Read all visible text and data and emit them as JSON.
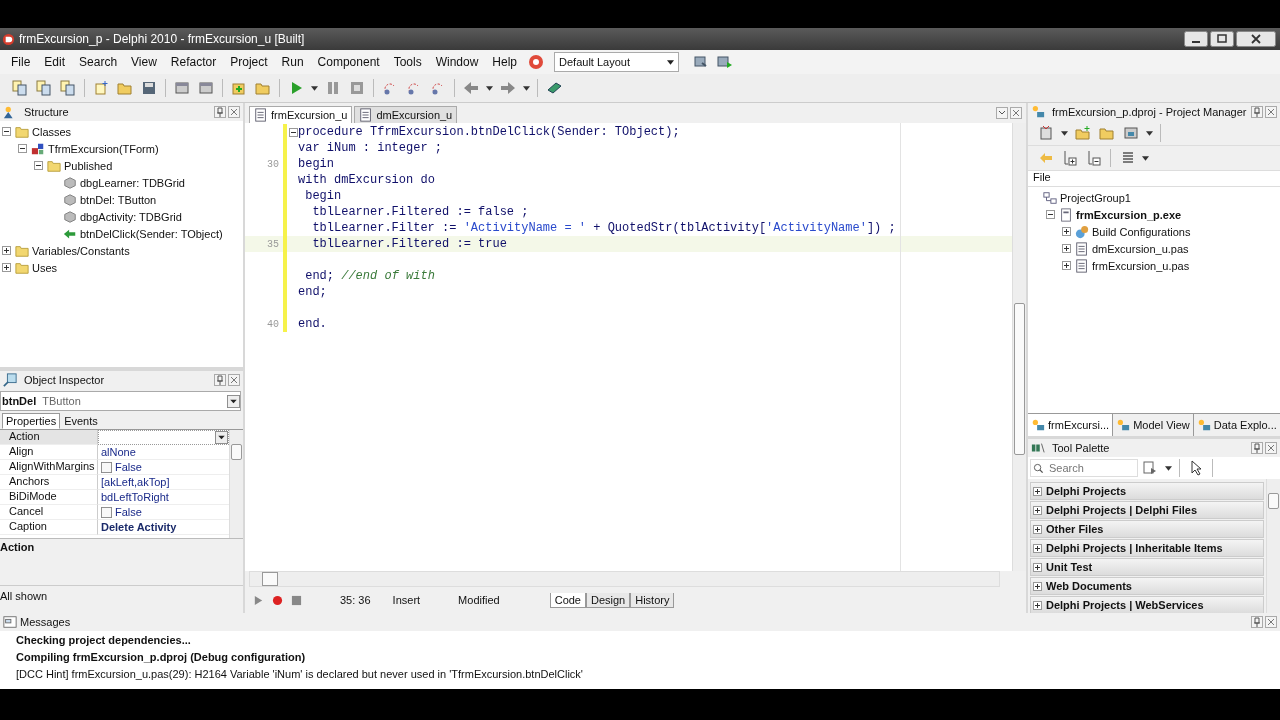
{
  "title_bar": {
    "title": "frmExcursion_p - Delphi 2010 - frmExcursion_u [Built]"
  },
  "menu": [
    "File",
    "Edit",
    "Search",
    "View",
    "Refactor",
    "Project",
    "Run",
    "Component",
    "Tools",
    "Window",
    "Help"
  ],
  "layout_combo": {
    "value": "Default Layout"
  },
  "structure": {
    "title": "Structure",
    "tree": [
      {
        "label": "Classes",
        "kind": "folder",
        "expanded": true,
        "children": [
          {
            "label": "TfrmExcursion(TForm)",
            "kind": "class",
            "expanded": true,
            "children": [
              {
                "label": "Published",
                "kind": "folder",
                "expanded": true,
                "children": [
                  {
                    "label": "dbgLearner: TDBGrid",
                    "kind": "component"
                  },
                  {
                    "label": "btnDel: TButton",
                    "kind": "component"
                  },
                  {
                    "label": "dbgActivity: TDBGrid",
                    "kind": "component"
                  },
                  {
                    "label": "btnDelClick(Sender: TObject)",
                    "kind": "method"
                  }
                ]
              }
            ]
          }
        ]
      },
      {
        "label": "Variables/Constants",
        "kind": "folder",
        "expanded": false
      },
      {
        "label": "Uses",
        "kind": "folder",
        "expanded": false
      }
    ]
  },
  "object_inspector": {
    "title": "Object Inspector",
    "object_name": "btnDel",
    "object_type": "TButton",
    "tabs": [
      {
        "label": "Properties",
        "selected": true
      },
      {
        "label": "Events",
        "selected": false
      }
    ],
    "rows": [
      {
        "name": "Action",
        "value": "",
        "kind": "combo",
        "selected": true
      },
      {
        "name": "Align",
        "value": "alNone",
        "kind": "text",
        "selected": false
      },
      {
        "name": "AlignWithMargins",
        "value": "False",
        "kind": "check",
        "checked": false,
        "selected": false
      },
      {
        "name": "Anchors",
        "value": "[akLeft,akTop]",
        "kind": "text",
        "selected": false
      },
      {
        "name": "BiDiMode",
        "value": "bdLeftToRight",
        "kind": "text",
        "selected": false
      },
      {
        "name": "Cancel",
        "value": "False",
        "kind": "check",
        "checked": false,
        "selected": false
      },
      {
        "name": "Caption",
        "value": "Delete Activity",
        "kind": "bold",
        "selected": false
      }
    ],
    "description": "Action",
    "footer": "All shown"
  },
  "editor": {
    "tabs": [
      {
        "label": "frmExcursion_u",
        "selected": true
      },
      {
        "label": "dmExcursion_u",
        "selected": false
      }
    ],
    "lines": [
      {
        "modified": true,
        "current": false,
        "fold": true,
        "segments": [
          {
            "kind": "keyword",
            "text": "procedure"
          },
          {
            "kind": "plain",
            "text": " TfrmExcursion.btnDelClick(Sender: TObject);"
          }
        ]
      },
      {
        "modified": true,
        "current": false,
        "segments": [
          {
            "kind": "keyword",
            "text": "var"
          },
          {
            "kind": "plain",
            "text": " iNum : integer ;"
          }
        ]
      },
      {
        "number": "30",
        "modified": true,
        "current": false,
        "segments": [
          {
            "kind": "keyword",
            "text": "begin"
          }
        ]
      },
      {
        "modified": true,
        "current": false,
        "segments": [
          {
            "kind": "keyword",
            "text": "with"
          },
          {
            "kind": "plain",
            "text": " dmExcursion "
          },
          {
            "kind": "keyword",
            "text": "do"
          }
        ]
      },
      {
        "modified": true,
        "current": false,
        "segments": [
          {
            "kind": "keyword",
            "text": " begin"
          }
        ]
      },
      {
        "modified": true,
        "current": false,
        "segments": [
          {
            "kind": "plain",
            "text": "  tblLearner.Filtered := false ;"
          }
        ]
      },
      {
        "modified": true,
        "current": false,
        "segments": [
          {
            "kind": "plain",
            "text": "  tblLearner.Filter := "
          },
          {
            "kind": "string",
            "text": "'ActivityName = '"
          },
          {
            "kind": "plain",
            "text": " + QuotedStr(tblActivity["
          },
          {
            "kind": "string",
            "text": "'ActivityName'"
          },
          {
            "kind": "plain",
            "text": "]) ;"
          }
        ]
      },
      {
        "number": "35",
        "modified": true,
        "current": true,
        "segments": [
          {
            "kind": "plain",
            "text": "  tblLearner.Filtered := true"
          }
        ]
      },
      {
        "modified": true,
        "current": false
      },
      {
        "modified": true,
        "current": false,
        "segments": [
          {
            "kind": "keyword",
            "text": " end;"
          },
          {
            "kind": "comment",
            "text": " //end of with"
          }
        ]
      },
      {
        "modified": true,
        "current": false,
        "segments": [
          {
            "kind": "keyword",
            "text": "end;"
          }
        ]
      },
      {
        "modified": true,
        "current": false
      },
      {
        "number": "40",
        "modified": true,
        "current": false,
        "segments": [
          {
            "kind": "keyword",
            "text": "end."
          }
        ]
      }
    ],
    "status": {
      "position": "35: 36",
      "mode": "Insert",
      "state": "Modified"
    },
    "view_tabs": [
      {
        "label": "Code",
        "selected": true
      },
      {
        "label": "Design",
        "selected": false
      },
      {
        "label": "History",
        "selected": false
      }
    ]
  },
  "project_manager": {
    "title": "frmExcursion_p.dproj - Project Manager",
    "column": "File",
    "tree": [
      {
        "label": "ProjectGroup1",
        "kind": "group",
        "bold": false,
        "children": [
          {
            "label": "frmExcursion_p.exe",
            "kind": "exe",
            "bold": true,
            "expanded": true,
            "children": [
              {
                "label": "Build Configurations",
                "kind": "config",
                "bold": false,
                "expanded": false
              },
              {
                "label": "dmExcursion_u.pas",
                "kind": "unit",
                "bold": false,
                "expanded": false
              },
              {
                "label": "frmExcursion_u.pas",
                "kind": "unit",
                "bold": false,
                "expanded": false
              }
            ]
          }
        ]
      }
    ],
    "tabs": [
      {
        "label": "frmExcursi...",
        "selected": true
      },
      {
        "label": "Model View",
        "selected": false
      },
      {
        "label": "Data Explo...",
        "selected": false
      }
    ]
  },
  "tool_palette": {
    "title": "Tool Palette",
    "search": {
      "placeholder": "Search"
    },
    "categories": [
      "Delphi Projects",
      "Delphi Projects | Delphi Files",
      "Other Files",
      "Delphi Projects | Inheritable Items",
      "Unit Test",
      "Web Documents",
      "Delphi Projects | WebServices"
    ]
  },
  "messages": {
    "title": "Messages",
    "lines": [
      {
        "text": "Checking project dependencies...",
        "bold": true
      },
      {
        "text": "Compiling frmExcursion_p.dproj (Debug configuration)",
        "bold": true
      },
      {
        "text": "[DCC Hint] frmExcursion_u.pas(29): H2164 Variable 'iNum' is declared but never used in 'TfrmExcursion.btnDelClick'",
        "bold": false
      }
    ]
  }
}
